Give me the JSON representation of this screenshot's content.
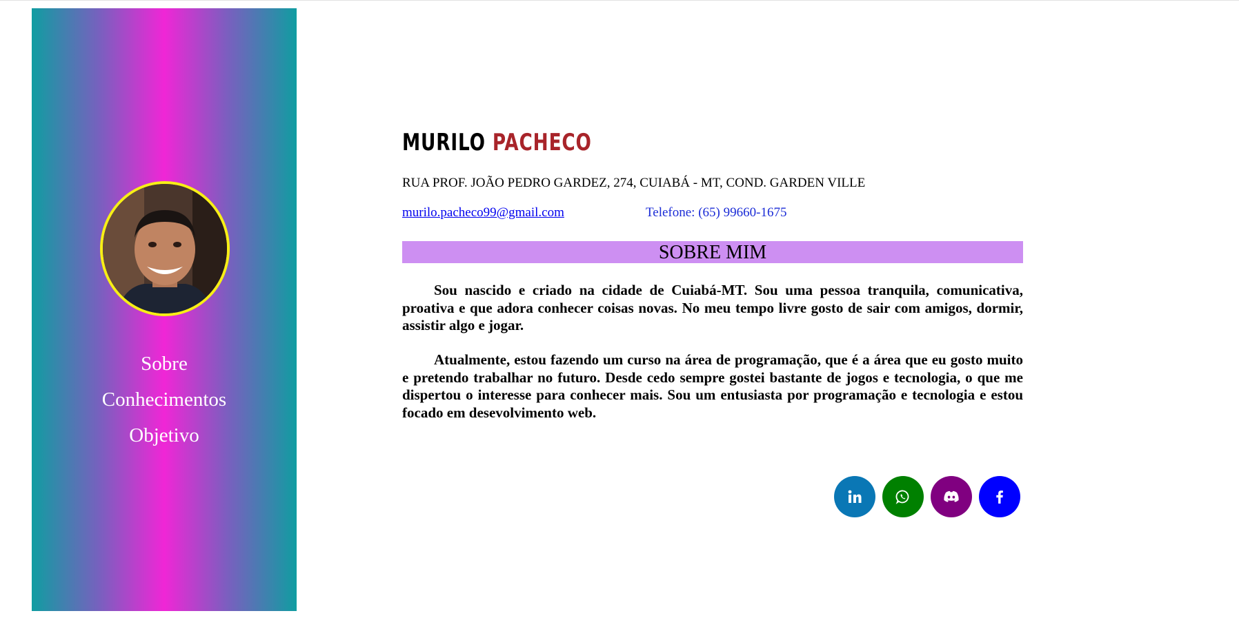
{
  "profile": {
    "first_name": "MURILO",
    "last_name": "PACHECO",
    "address": "RUA PROF. JOÃO PEDRO GARDEZ, 274, CUIABÁ - MT, COND. GARDEN VILLE",
    "email": "murilo.pacheco99@gmail.com",
    "phone": "Telefone: (65) 99660-1675"
  },
  "sidebar": {
    "nav": [
      {
        "label": "Sobre"
      },
      {
        "label": "Conhecimentos"
      },
      {
        "label": "Objetivo"
      }
    ]
  },
  "about": {
    "heading": "SOBRE MIM",
    "paragraphs": [
      "Sou nascido e criado na cidade de Cuiabá-MT. Sou uma pessoa tranquila, comunicativa, proativa e que adora conhecer coisas novas. No meu tempo livre gosto de sair com amigos, dormir, assistir algo e jogar.",
      "Atualmente, estou fazendo um curso na área de programação, que é a área que eu gosto muito e pretendo trabalhar no futuro. Desde cedo sempre gostei bastante de jogos e tecnologia, o que me dispertou o interesse para conhecer mais. Sou um entusiasta por programação e tecnologia e estou focado em desevolvimento web."
    ]
  },
  "socials": [
    {
      "icon": "linkedin-icon",
      "color": "#0a77b5"
    },
    {
      "icon": "whatsapp-icon",
      "color": "#008000"
    },
    {
      "icon": "discord-icon",
      "color": "#800080"
    },
    {
      "icon": "facebook-icon",
      "color": "#0000ff"
    }
  ],
  "colors": {
    "sidebar_gradient": [
      "#109da1",
      "#f026d6"
    ],
    "avatar_border": "#f7ef16",
    "last_name": "#a8242a",
    "section_heading_bg": "#cd8ff2",
    "link": "#0000ee"
  }
}
